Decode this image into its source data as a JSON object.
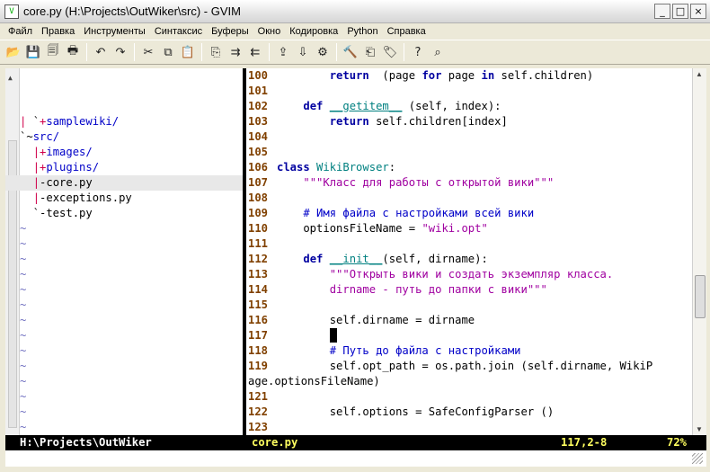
{
  "window": {
    "title": "core.py (H:\\Projects\\OutWiker\\src) - GVIM",
    "app_icon": "vim-icon",
    "buttons": [
      "_",
      "□",
      "×"
    ]
  },
  "menu": [
    "Файл",
    "Правка",
    "Инструменты",
    "Синтаксис",
    "Буферы",
    "Окно",
    "Кодировка",
    "Python",
    "Справка"
  ],
  "toolbar": [
    {
      "icon": "open-icon",
      "glyph": "📂"
    },
    {
      "icon": "save-icon",
      "glyph": "💾"
    },
    {
      "icon": "save-all-icon",
      "glyph": "🗐"
    },
    {
      "icon": "print-icon",
      "glyph": "🖶"
    },
    {
      "sep": true
    },
    {
      "icon": "undo-icon",
      "glyph": "↶"
    },
    {
      "icon": "redo-icon",
      "glyph": "↷"
    },
    {
      "sep": true
    },
    {
      "icon": "cut-icon",
      "glyph": "✂"
    },
    {
      "icon": "copy-icon",
      "glyph": "⧉"
    },
    {
      "icon": "paste-icon",
      "glyph": "📋"
    },
    {
      "sep": true
    },
    {
      "icon": "find-replace-icon",
      "glyph": "⎘"
    },
    {
      "icon": "find-next-icon",
      "glyph": "⇉"
    },
    {
      "icon": "find-prev-icon",
      "glyph": "⇇"
    },
    {
      "sep": true
    },
    {
      "icon": "load-session-icon",
      "glyph": "⇪"
    },
    {
      "icon": "save-session-icon",
      "glyph": "⇩"
    },
    {
      "icon": "run-script-icon",
      "glyph": "⚙"
    },
    {
      "sep": true
    },
    {
      "icon": "make-icon",
      "glyph": "🔨"
    },
    {
      "icon": "build-tags-icon",
      "glyph": "⎗"
    },
    {
      "icon": "jump-tag-icon",
      "glyph": "🏷"
    },
    {
      "sep": true
    },
    {
      "icon": "help-icon",
      "glyph": "?"
    },
    {
      "icon": "find-help-icon",
      "glyph": "⌕"
    }
  ],
  "tree": [
    {
      "parts": [
        [
          "bar",
          "| "
        ],
        [
          "",
          "`"
        ],
        [
          "plus",
          "+"
        ],
        [
          "dir",
          "samplewiki/"
        ]
      ]
    },
    {
      "parts": [
        [
          "",
          "`~"
        ],
        [
          "dir",
          "src/"
        ]
      ]
    },
    {
      "parts": [
        [
          "",
          "  "
        ],
        [
          "bar",
          "|"
        ],
        [
          "plus",
          "+"
        ],
        [
          "dir",
          "images/"
        ]
      ]
    },
    {
      "parts": [
        [
          "",
          "  "
        ],
        [
          "bar",
          "|"
        ],
        [
          "plus",
          "+"
        ],
        [
          "dir",
          "plugins/"
        ]
      ]
    },
    {
      "parts": [
        [
          "",
          "  "
        ],
        [
          "bar",
          "|"
        ],
        [
          "",
          "-core.py"
        ]
      ],
      "current": true
    },
    {
      "parts": [
        [
          "",
          "  "
        ],
        [
          "bar",
          "|"
        ],
        [
          "",
          "-exceptions.py"
        ]
      ]
    },
    {
      "parts": [
        [
          "",
          "  `-test.py"
        ]
      ]
    },
    {
      "parts": [
        [
          "tilde",
          "~"
        ]
      ]
    },
    {
      "parts": [
        [
          "tilde",
          "~"
        ]
      ]
    },
    {
      "parts": [
        [
          "tilde",
          "~"
        ]
      ]
    },
    {
      "parts": [
        [
          "tilde",
          "~"
        ]
      ]
    },
    {
      "parts": [
        [
          "tilde",
          "~"
        ]
      ]
    },
    {
      "parts": [
        [
          "tilde",
          "~"
        ]
      ]
    },
    {
      "parts": [
        [
          "tilde",
          "~"
        ]
      ]
    },
    {
      "parts": [
        [
          "tilde",
          "~"
        ]
      ]
    },
    {
      "parts": [
        [
          "tilde",
          "~"
        ]
      ]
    },
    {
      "parts": [
        [
          "tilde",
          "~"
        ]
      ]
    },
    {
      "parts": [
        [
          "tilde",
          "~"
        ]
      ]
    },
    {
      "parts": [
        [
          "tilde",
          "~"
        ]
      ]
    },
    {
      "parts": [
        [
          "tilde",
          "~"
        ]
      ]
    },
    {
      "parts": [
        [
          "tilde",
          "~"
        ]
      ]
    },
    {
      "parts": [
        [
          "tilde",
          "~"
        ]
      ]
    },
    {
      "parts": [
        [
          "tilde",
          "~"
        ]
      ]
    },
    {
      "parts": [
        [
          "tilde",
          "~"
        ]
      ]
    }
  ],
  "code": [
    {
      "ln": "100",
      "parts": [
        [
          "",
          "        "
        ],
        [
          "kw",
          "return"
        ],
        [
          "",
          "  (page "
        ],
        [
          "kw",
          "for"
        ],
        [
          "",
          " page "
        ],
        [
          "kw",
          "in"
        ],
        [
          "",
          " self.children)"
        ]
      ]
    },
    {
      "ln": "101",
      "parts": []
    },
    {
      "ln": "102",
      "parts": [
        [
          "",
          "    "
        ],
        [
          "kw",
          "def"
        ],
        [
          "",
          " "
        ],
        [
          "fn",
          "__getitem__"
        ],
        [
          "",
          " (self, index):"
        ]
      ]
    },
    {
      "ln": "103",
      "parts": [
        [
          "",
          "        "
        ],
        [
          "kw",
          "return"
        ],
        [
          "",
          " self.children[index]"
        ]
      ]
    },
    {
      "ln": "104",
      "parts": []
    },
    {
      "ln": "105",
      "parts": []
    },
    {
      "ln": "106",
      "parts": [
        [
          "kw",
          "class"
        ],
        [
          "",
          " "
        ],
        [
          "cls",
          "WikiBrowser"
        ],
        [
          "",
          ":"
        ]
      ]
    },
    {
      "ln": "107",
      "parts": [
        [
          "",
          "    "
        ],
        [
          "str",
          "\"\"\"Класс для работы с открытой вики\"\"\""
        ]
      ]
    },
    {
      "ln": "108",
      "parts": []
    },
    {
      "ln": "109",
      "parts": [
        [
          "",
          "    "
        ],
        [
          "cmt",
          "# Имя файла с настройками всей вики"
        ]
      ]
    },
    {
      "ln": "110",
      "parts": [
        [
          "",
          "    optionsFileName = "
        ],
        [
          "str",
          "\"wiki.opt\""
        ]
      ]
    },
    {
      "ln": "111",
      "parts": []
    },
    {
      "ln": "112",
      "parts": [
        [
          "",
          "    "
        ],
        [
          "kw",
          "def"
        ],
        [
          "",
          " "
        ],
        [
          "fn",
          "__init__"
        ],
        [
          "",
          "(self, dirname):"
        ]
      ]
    },
    {
      "ln": "113",
      "parts": [
        [
          "",
          "        "
        ],
        [
          "str",
          "\"\"\"Открыть вики и создать экземпляр класса."
        ]
      ]
    },
    {
      "ln": "114",
      "parts": [
        [
          "",
          "        "
        ],
        [
          "str",
          "dirname - путь до папки с вики\"\"\""
        ]
      ]
    },
    {
      "ln": "115",
      "parts": []
    },
    {
      "ln": "116",
      "parts": [
        [
          "",
          "        self.dirname = dirname"
        ]
      ]
    },
    {
      "ln": "117",
      "parts": [
        [
          "",
          "        "
        ],
        [
          "cursor",
          " "
        ]
      ]
    },
    {
      "ln": "118",
      "parts": [
        [
          "",
          "        "
        ],
        [
          "cmt",
          "# Путь до файла с настройками"
        ]
      ]
    },
    {
      "ln": "119",
      "parts": [
        [
          "",
          "        self.opt_path = os.path.join (self.dirname, WikiP"
        ]
      ]
    },
    {
      "ln": "",
      "parts": [
        [
          "",
          "age.optionsFileName)"
        ]
      ]
    },
    {
      "ln": "121",
      "parts": []
    },
    {
      "ln": "122",
      "parts": [
        [
          "",
          "        self.options = SafeConfigParser ()"
        ]
      ]
    },
    {
      "ln": "123",
      "parts": []
    }
  ],
  "status": {
    "tree_path": "H:\\Projects\\OutWiker",
    "file": "core.py",
    "position": "117,2-8",
    "percent": "72%"
  }
}
